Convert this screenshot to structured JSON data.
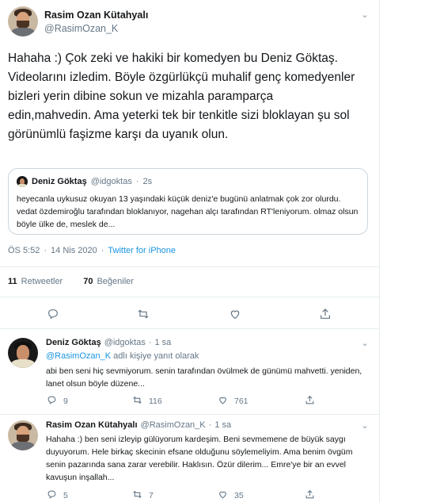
{
  "tweet": {
    "author_name": "Rasim Ozan Kütahyalı",
    "author_handle": "@RasimOzan_K",
    "text": "Hahaha :) Çok zeki ve hakiki bir komedyen bu Deniz Göktaş. Videolarını izledim. Böyle özgürlükçü muhalif genç komedyenler bizleri yerin dibine sokun ve mizahla paramparça edin,mahvedin. Ama yeterki tek bir tenkitle sizi bloklayan şu sol görünümlü faşizme karşı da uyanık olun.",
    "quote": {
      "author_name": "Deniz Göktaş",
      "author_handle": "@idgoktas",
      "time": "2s",
      "text": "heyecanla uykusuz okuyan 13 yaşındaki küçük deniz'e bugünü anlatmak çok zor olurdu. vedat özdemiroğlu tarafından bloklanıyor, nagehan alçı tarafından RT'leniyorum. olmaz olsun böyle ülke de, meslek de..."
    },
    "time": "ÖS 5:52",
    "date": "14 Nis 2020",
    "source": "Twitter for iPhone",
    "retweet_count": "11",
    "retweet_label": "Retweetler",
    "like_count": "70",
    "like_label": "Beğeniler",
    "icons": [
      "reply-icon",
      "retweet-icon",
      "like-icon",
      "share-icon",
      "chevron-down-icon"
    ]
  },
  "replies": [
    {
      "author_name": "Deniz Göktaş",
      "author_handle": "@idgoktas",
      "time": "1 sa",
      "replying_to": "@RasimOzan_K",
      "replying_suffix": "adlı kişiye yanıt olarak",
      "text": "abi ben seni hiç sevmiyorum. senin tarafından övülmek de günümü mahvetti. yeniden, lanet olsun böyle düzene...",
      "reply_count": "9",
      "retweet_count": "116",
      "like_count": "761"
    },
    {
      "author_name": "Rasim Ozan Kütahyalı",
      "author_handle": "@RasimOzan_K",
      "time": "1 sa",
      "text": "Hahaha :) ben seni izleyip gülüyorum kardeşim. Beni sevmemene de büyük saygı duyuyorum. Hele birkaç skecinin efsane olduğunu söylemeliyim. Ama benim övgüm senin pazarında sana zarar verebilir. Haklısın. Özür dilerim... Emre'ye bir an evvel kavuşun inşallah...",
      "reply_count": "5",
      "retweet_count": "7",
      "like_count": "35"
    }
  ],
  "colors": {
    "text": "#14171a",
    "muted": "#657786",
    "link": "#1b95e0",
    "border": "#e6ecf0"
  }
}
